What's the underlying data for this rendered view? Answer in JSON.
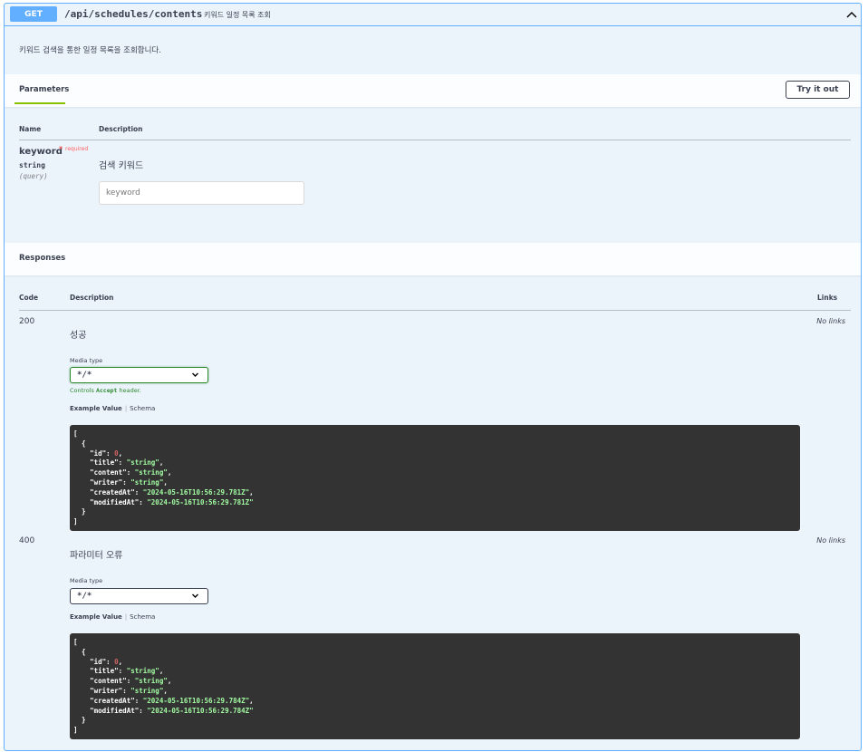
{
  "operation": {
    "method": "GET",
    "path": "/api/schedules/contents",
    "summary": "키워드 일정 목록 조회",
    "description": "키워드 검색을 통한 일정 목록을 조회합니다."
  },
  "parameters": {
    "title": "Parameters",
    "try_button": "Try it out",
    "col_name": "Name",
    "col_desc": "Description",
    "items": [
      {
        "name": "keyword",
        "required_star": "*",
        "required_label": "required",
        "type": "string",
        "in": "(query)",
        "description": "검색 키워드",
        "placeholder": "keyword"
      }
    ]
  },
  "responses": {
    "title": "Responses",
    "col_code": "Code",
    "col_desc": "Description",
    "col_links": "Links",
    "items": [
      {
        "code": "200",
        "description": "성공",
        "links": "No links",
        "media_label": "Media type",
        "media_value": "*/*",
        "controls_pre": "Controls ",
        "controls_code": "Accept",
        "controls_post": " header.",
        "example_tab": "Example Value",
        "schema_tab": "Schema",
        "example": {
          "id": "0",
          "title": "\"string\"",
          "content": "\"string\"",
          "writer": "\"string\"",
          "createdAt": "\"2024-05-16T10:56:29.781Z\"",
          "modifiedAt": "\"2024-05-16T10:56:29.781Z\""
        }
      },
      {
        "code": "400",
        "description": "파라미터 오류",
        "links": "No links",
        "media_label": "Media type",
        "media_value": "*/*",
        "example_tab": "Example Value",
        "schema_tab": "Schema",
        "example": {
          "id": "0",
          "title": "\"string\"",
          "content": "\"string\"",
          "writer": "\"string\"",
          "createdAt": "\"2024-05-16T10:56:29.784Z\"",
          "modifiedAt": "\"2024-05-16T10:56:29.784Z\""
        }
      }
    ]
  },
  "colors": {
    "get_blue": "#61affe",
    "block_bg": "#ebf3fb",
    "code_bg": "#333333",
    "string_green": "#a2fca2",
    "number_red": "#d36363",
    "required_red": "#ff6060",
    "ok_green": "#2d8a2d"
  },
  "icons": {
    "collapse": "chevron-up-icon",
    "select": "chevron-down-icon"
  }
}
